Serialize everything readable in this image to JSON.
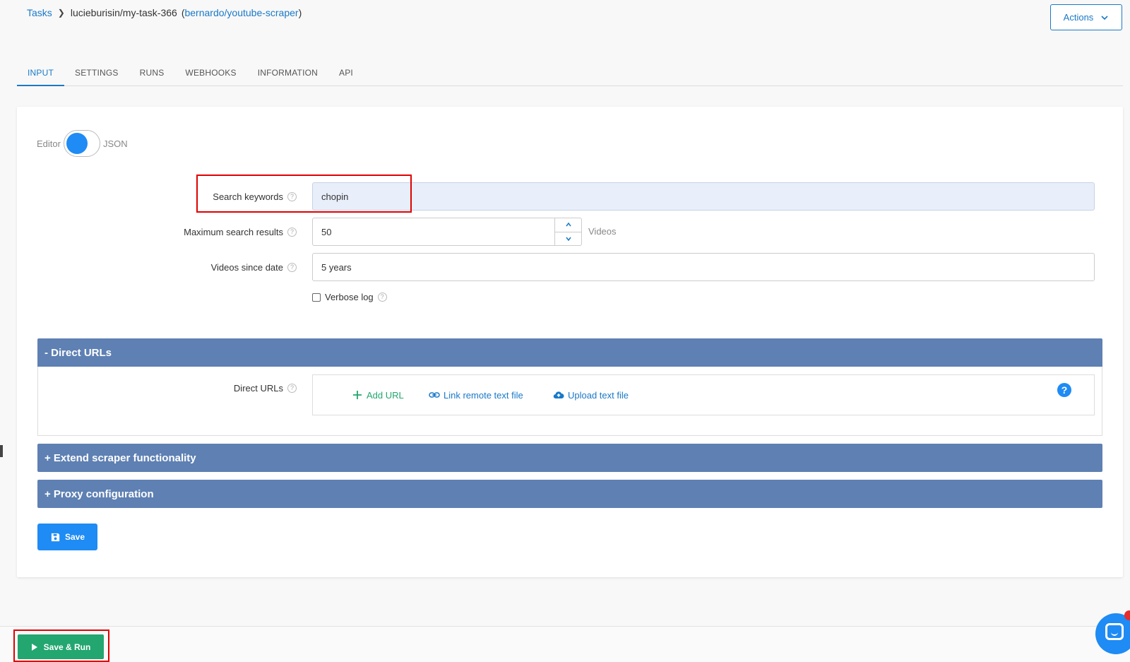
{
  "breadcrumb": {
    "root": "Tasks",
    "task": "lucieburisin/my-task-366",
    "open_paren": "(",
    "actor": "bernardo/youtube-scraper",
    "close_paren": ")"
  },
  "header": {
    "actions_label": "Actions"
  },
  "tabs": [
    {
      "label": "INPUT",
      "active": true
    },
    {
      "label": "SETTINGS"
    },
    {
      "label": "RUNS"
    },
    {
      "label": "WEBHOOKS"
    },
    {
      "label": "INFORMATION"
    },
    {
      "label": "API"
    }
  ],
  "mode_toggle": {
    "left_label": "Editor",
    "right_label": "JSON"
  },
  "form": {
    "search_keywords": {
      "label": "Search keywords",
      "value": "chopin"
    },
    "max_results": {
      "label": "Maximum search results",
      "value": "50",
      "unit": "Videos"
    },
    "since_date": {
      "label": "Videos since date",
      "value": "5 years"
    },
    "verbose_log": {
      "label": "Verbose log",
      "checked": false
    },
    "help_glyph": "?"
  },
  "sections": {
    "direct_urls": {
      "title": "- Direct URLs",
      "field_label": "Direct URLs",
      "add_url": "Add URL",
      "link_remote": "Link remote text file",
      "upload": "Upload text file",
      "help": "?"
    },
    "extend": {
      "title": "+ Extend scraper functionality"
    },
    "proxy": {
      "title": "+ Proxy configuration"
    }
  },
  "buttons": {
    "save": "Save",
    "save_run": "Save & Run"
  },
  "colors": {
    "accent": "#1979c8",
    "primary_button": "#1f8bf4",
    "section_bar": "#5e80b3",
    "success": "#23a66f",
    "highlight_box": "#e00000"
  }
}
